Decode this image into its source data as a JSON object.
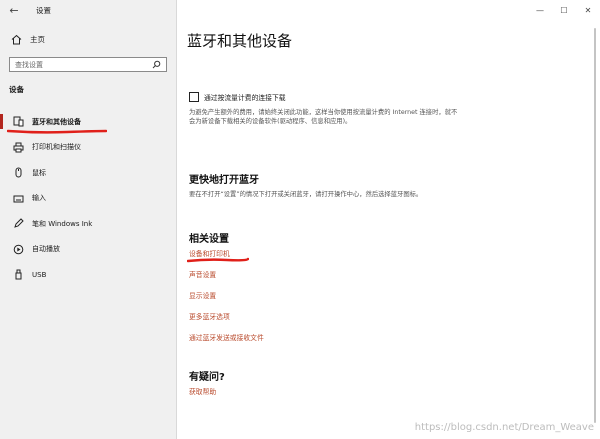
{
  "window": {
    "title": "设置"
  },
  "window_controls": {
    "minimize": "—",
    "maximize": "☐",
    "close": "✕"
  },
  "sidebar": {
    "back": "←",
    "home_label": "主页",
    "search_placeholder": "查找设置",
    "section": "设备",
    "items": [
      {
        "label": "蓝牙和其他设备",
        "icon": "bluetooth-devices-icon",
        "active": true
      },
      {
        "label": "打印机和扫描仪",
        "icon": "printer-icon",
        "active": false
      },
      {
        "label": "鼠标",
        "icon": "mouse-icon",
        "active": false
      },
      {
        "label": "输入",
        "icon": "keyboard-icon",
        "active": false
      },
      {
        "label": "笔和 Windows Ink",
        "icon": "pen-icon",
        "active": false
      },
      {
        "label": "自动播放",
        "icon": "autoplay-icon",
        "active": false
      },
      {
        "label": "USB",
        "icon": "usb-icon",
        "active": false
      }
    ]
  },
  "main": {
    "title": "蓝牙和其他设备",
    "metered": {
      "checkbox_label": "通过按流量计费的连接下载",
      "checked": false,
      "description": "为避免产生额外的费用，请始终关闭此功能，这样当你使用按流量计费的 Internet 连接时，就不会为新设备下载相关的设备软件(驱动程序、信息和应用)。"
    },
    "quick": {
      "heading": "更快地打开蓝牙",
      "description": "要在不打开“设置”的情况下打开或关闭蓝牙，请打开操作中心，然后选择蓝牙图标。"
    },
    "related": {
      "heading": "相关设置",
      "links": [
        "设备和打印机",
        "声音设置",
        "显示设置",
        "更多蓝牙选项",
        "通过蓝牙发送或接收文件"
      ]
    },
    "question": {
      "heading": "有疑问?",
      "link": "获取帮助"
    }
  },
  "watermark": "https://blog.csdn.net/Dream_Weave",
  "colors": {
    "link": "#b94a2c",
    "sidebar_bg": "#f0f0f0",
    "annotation": "#e0201a"
  }
}
